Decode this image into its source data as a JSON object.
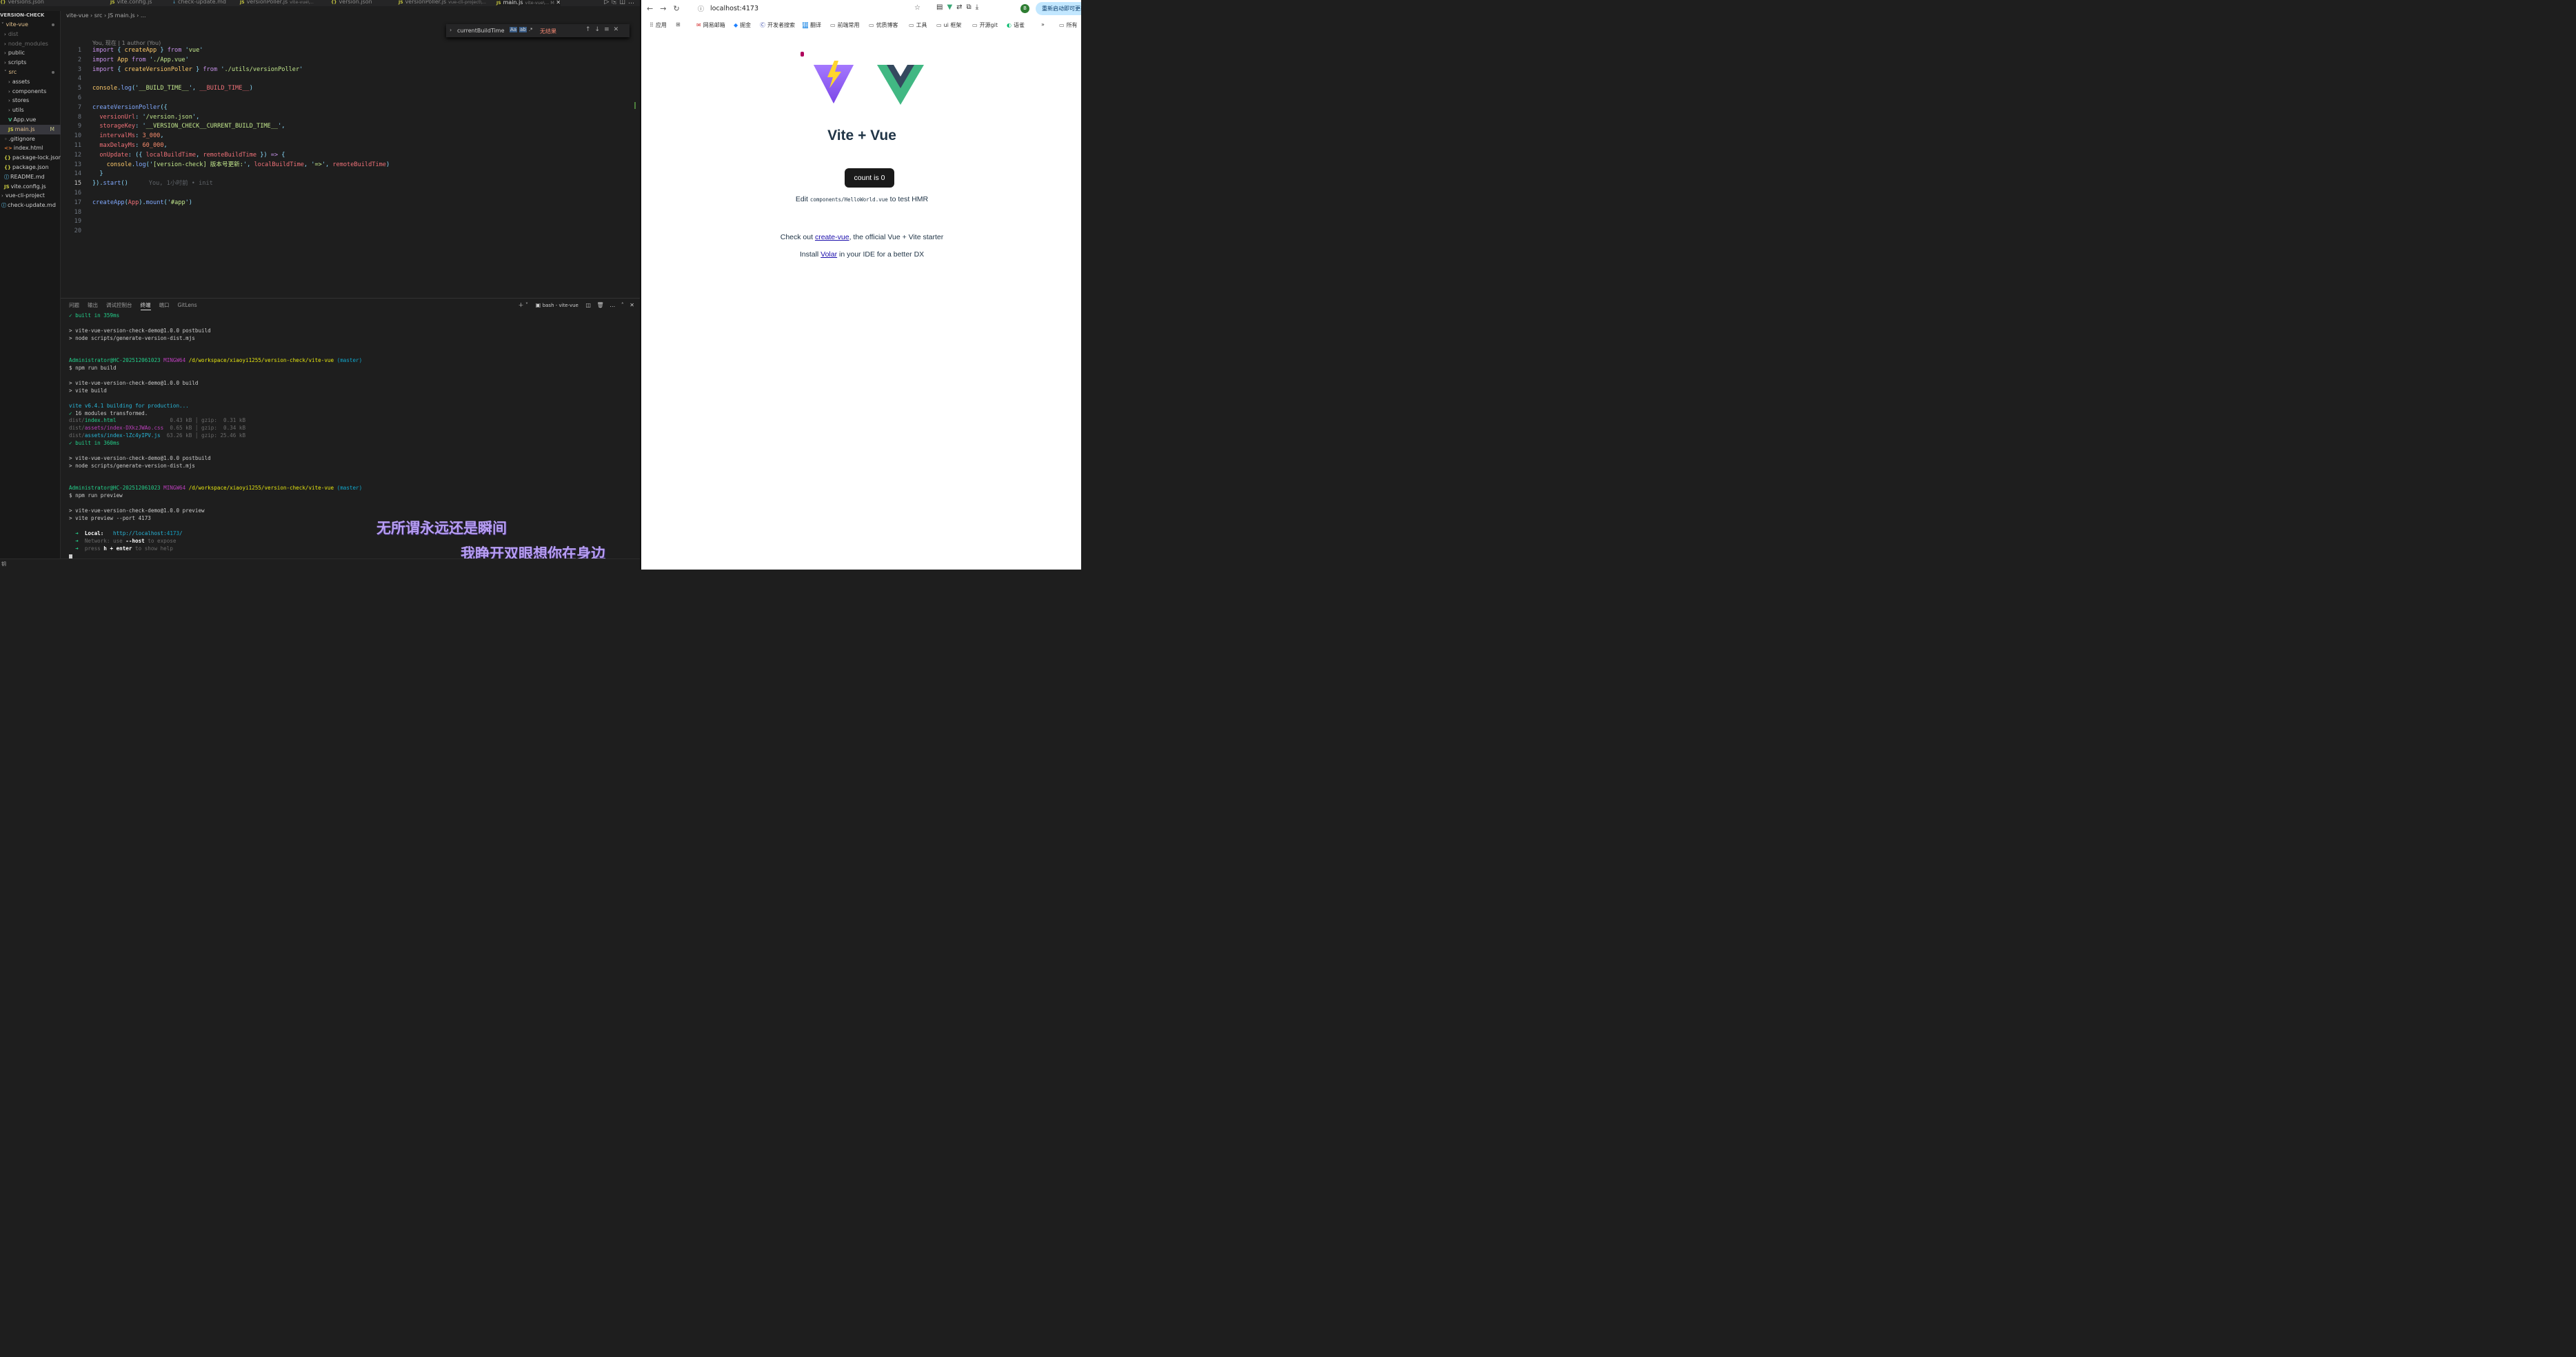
{
  "editor": {
    "tabs": [
      {
        "label": "versions.json",
        "type": "json"
      },
      {
        "label": "vite.config.js",
        "type": "js"
      },
      {
        "label": "check-update.md",
        "type": "md"
      },
      {
        "label": "versionPoller.js",
        "hint": "vite-vue\\...",
        "type": "js"
      },
      {
        "label": "version.json",
        "type": "json"
      },
      {
        "label": "versionPoller.js",
        "hint": "vue-cli-project\\...",
        "type": "js"
      },
      {
        "label": "main.js",
        "hint": "vite-vue\\... M",
        "type": "js",
        "active": true
      }
    ],
    "sidebar": {
      "title": "VERSION-CHECK",
      "items": [
        {
          "label": "vite-vue",
          "kind": "folder-open",
          "depth": 0,
          "color": "#e2c08d"
        },
        {
          "label": "dist",
          "kind": "folder",
          "depth": 1,
          "color": "#6b6b6b"
        },
        {
          "label": "node_modules",
          "kind": "folder",
          "depth": 1,
          "color": "#6b6b6b"
        },
        {
          "label": "public",
          "kind": "folder",
          "depth": 1
        },
        {
          "label": "scripts",
          "kind": "folder",
          "depth": 1
        },
        {
          "label": "src",
          "kind": "folder-open",
          "depth": 1,
          "color": "#e2c08d"
        },
        {
          "label": "assets",
          "kind": "folder",
          "depth": 2
        },
        {
          "label": "components",
          "kind": "folder",
          "depth": 2
        },
        {
          "label": "stores",
          "kind": "folder",
          "depth": 2
        },
        {
          "label": "utils",
          "kind": "folder",
          "depth": 2
        },
        {
          "label": "App.vue",
          "kind": "vue",
          "depth": 2
        },
        {
          "label": "main.js",
          "kind": "js",
          "depth": 2,
          "color": "#e2c08d",
          "mod": "M",
          "selected": true
        },
        {
          "label": ".gitignore",
          "kind": "file",
          "depth": 1
        },
        {
          "label": "index.html",
          "kind": "html",
          "depth": 1
        },
        {
          "label": "package-lock.json",
          "kind": "json",
          "depth": 1
        },
        {
          "label": "package.json",
          "kind": "json",
          "depth": 1
        },
        {
          "label": "README.md",
          "kind": "md",
          "depth": 1
        },
        {
          "label": "vite.config.js",
          "kind": "js",
          "depth": 1
        },
        {
          "label": "vue-cli-project",
          "kind": "folder",
          "depth": 0
        },
        {
          "label": "check-update.md",
          "kind": "md",
          "depth": 0
        }
      ]
    },
    "breadcrumb": [
      "vite-vue",
      "src",
      "JS main.js",
      "..."
    ],
    "find": {
      "query": "currentBuildTime",
      "options": "Aa ab .*",
      "result": "无结果"
    },
    "blame_header": "You, 现在 | 1 author (You)",
    "inline_blame": "You, 1小时前 • init",
    "code": [
      [
        [
          "import ",
          "k2"
        ],
        [
          "{ ",
          "pn"
        ],
        [
          "createApp ",
          "yl"
        ],
        [
          "} ",
          "pn"
        ],
        [
          "from ",
          "k2"
        ],
        [
          "'",
          "pn"
        ],
        [
          "vue",
          "gr"
        ],
        [
          "'",
          "pn"
        ]
      ],
      [
        [
          "import ",
          "k2"
        ],
        [
          "App ",
          "yl"
        ],
        [
          "from ",
          "k2"
        ],
        [
          "'",
          "pn"
        ],
        [
          "./App.vue",
          "gr"
        ],
        [
          "'",
          "pn"
        ]
      ],
      [
        [
          "import ",
          "k2"
        ],
        [
          "{ ",
          "pn"
        ],
        [
          "createVersionPoller ",
          "yl"
        ],
        [
          "} ",
          "pn"
        ],
        [
          "from ",
          "k2"
        ],
        [
          "'",
          "pn"
        ],
        [
          "./utils/versionPoller",
          "gr"
        ],
        [
          "'",
          "pn"
        ]
      ],
      [],
      [
        [
          "console",
          "yl"
        ],
        [
          ".",
          "pn"
        ],
        [
          "log",
          "bl"
        ],
        [
          "(",
          "pn"
        ],
        [
          "'",
          "pn"
        ],
        [
          "__BUILD_TIME__",
          "gr"
        ],
        [
          "', ",
          "pn"
        ],
        [
          "__BUILD_TIME__",
          "vr"
        ],
        [
          ")",
          "pn"
        ]
      ],
      [],
      [
        [
          "createVersionPoller",
          "bl"
        ],
        [
          "({",
          "pn"
        ]
      ],
      [
        [
          "  versionUrl",
          "vr"
        ],
        [
          ": ",
          "pn"
        ],
        [
          "'",
          "pn"
        ],
        [
          "/version.json",
          "gr"
        ],
        [
          "',",
          "pn"
        ]
      ],
      [
        [
          "  storageKey",
          "vr"
        ],
        [
          ": ",
          "pn"
        ],
        [
          "'",
          "pn"
        ],
        [
          "__VERSION_CHECK__CURRENT_BUILD_TIME__",
          "gr"
        ],
        [
          "',",
          "pn"
        ]
      ],
      [
        [
          "  intervalMs",
          "vr"
        ],
        [
          ": ",
          "pn"
        ],
        [
          "3_000",
          "nm"
        ],
        [
          ",",
          "pn"
        ]
      ],
      [
        [
          "  maxDelayMs",
          "vr"
        ],
        [
          ": ",
          "pn"
        ],
        [
          "60_000",
          "nm"
        ],
        [
          ",",
          "pn"
        ]
      ],
      [
        [
          "  onUpdate",
          "vr"
        ],
        [
          ": ",
          "pn"
        ],
        [
          "({ ",
          "pn"
        ],
        [
          "localBuildTime",
          "vr"
        ],
        [
          ", ",
          "pn"
        ],
        [
          "remoteBuildTime ",
          "vr"
        ],
        [
          "}) ",
          "pn"
        ],
        [
          "=> ",
          "k2"
        ],
        [
          "{",
          "pn"
        ]
      ],
      [
        [
          "    console",
          "yl"
        ],
        [
          ".",
          "pn"
        ],
        [
          "log",
          "bl"
        ],
        [
          "(",
          "pn"
        ],
        [
          "'",
          "pn"
        ],
        [
          "[version-check] 版本号更新:",
          "gr"
        ],
        [
          "', ",
          "pn"
        ],
        [
          "localBuildTime",
          "vr"
        ],
        [
          ", ",
          "pn"
        ],
        [
          "'",
          "pn"
        ],
        [
          "=>",
          "gr"
        ],
        [
          "', ",
          "pn"
        ],
        [
          "remoteBuildTime",
          "vr"
        ],
        [
          ")",
          "pn"
        ]
      ],
      [
        [
          "  }",
          "pn"
        ]
      ],
      [
        [
          "})",
          "pn"
        ],
        [
          ".",
          "pn"
        ],
        [
          "start",
          "bl"
        ],
        [
          "()",
          "pn"
        ]
      ],
      [],
      [
        [
          "createApp",
          "bl"
        ],
        [
          "(",
          "pn"
        ],
        [
          "App",
          "vr"
        ],
        [
          ")",
          "pn"
        ],
        [
          ".",
          "pn"
        ],
        [
          "mount",
          "bl"
        ],
        [
          "(",
          "pn"
        ],
        [
          "'",
          "pn"
        ],
        [
          "#app",
          "gr"
        ],
        [
          "')",
          "pn"
        ]
      ],
      [],
      [],
      []
    ],
    "current_line": 15,
    "panel_tabs": [
      "问题",
      "输出",
      "调试控制台",
      "终端",
      "端口",
      "GitLens"
    ],
    "active_panel_tab": "终端",
    "terminal_name": "bash - vite-vue",
    "terminal": [
      [
        [
          "✓ built in 359ms",
          "g"
        ]
      ],
      [],
      [
        [
          "> vite-vue-version-check-demo@1.0.0 postbuild",
          ""
        ]
      ],
      [
        [
          "> node scripts/generate-version-dist.mjs",
          ""
        ]
      ],
      [],
      [],
      [
        [
          "Administrator@HC-202512061023 ",
          "g"
        ],
        [
          "MINGW64 ",
          "m"
        ],
        [
          "/d/workspace/xiaoyi1255/version-check/vite-vue ",
          "yel"
        ],
        [
          "(master)",
          "cy"
        ]
      ],
      [
        [
          "$ npm run build",
          ""
        ]
      ],
      [],
      [
        [
          "> vite-vue-version-check-demo@1.0.0 build",
          ""
        ]
      ],
      [
        [
          "> vite build",
          ""
        ]
      ],
      [],
      [
        [
          "vite v6.4.1 building for production...",
          "c"
        ]
      ],
      [
        [
          "✓ ",
          "g"
        ],
        [
          "16 modules transformed.",
          ""
        ]
      ],
      [
        [
          "dist/",
          "dim"
        ],
        [
          "index.html                 ",
          "g"
        ],
        [
          "0.43 kB",
          "dim"
        ],
        [
          " │ gzip:  0.31 kB",
          "dim"
        ]
      ],
      [
        [
          "dist/",
          "dim"
        ],
        [
          "assets/index-DXkzJWAo.css  ",
          "m"
        ],
        [
          "0.65 kB",
          "dim"
        ],
        [
          " │ gzip:  0.34 kB",
          "dim"
        ]
      ],
      [
        [
          "dist/",
          "dim"
        ],
        [
          "assets/index-lZc4yIPV.js  ",
          "c"
        ],
        [
          "63.26 kB",
          "dim"
        ],
        [
          " │ gzip: 25.46 kB",
          "dim"
        ]
      ],
      [
        [
          "✓ built in 360ms",
          "g"
        ]
      ],
      [],
      [
        [
          "> vite-vue-version-check-demo@1.0.0 postbuild",
          ""
        ]
      ],
      [
        [
          "> node scripts/generate-version-dist.mjs",
          ""
        ]
      ],
      [],
      [],
      [
        [
          "Administrator@HC-202512061023 ",
          "g"
        ],
        [
          "MINGW64 ",
          "m"
        ],
        [
          "/d/workspace/xiaoyi1255/version-check/vite-vue ",
          "yel"
        ],
        [
          "(master)",
          "cy"
        ]
      ],
      [
        [
          "$ npm run preview",
          ""
        ]
      ],
      [],
      [
        [
          "> vite-vue-version-check-demo@1.0.0 preview",
          ""
        ]
      ],
      [
        [
          "> vite preview --port 4173",
          ""
        ]
      ],
      [],
      [
        [
          "  ➜  ",
          "g"
        ],
        [
          "Local:   ",
          "wb"
        ],
        [
          "http://localhost:",
          "c"
        ],
        [
          "4173",
          "cy"
        ],
        [
          "/",
          "c"
        ]
      ],
      [
        [
          "  ➜  ",
          "g"
        ],
        [
          "Network: use ",
          "dim"
        ],
        [
          "--host",
          "wb"
        ],
        [
          " to expose",
          "dim"
        ]
      ],
      [
        [
          "  ➜  ",
          "g"
        ],
        [
          "press ",
          "dim"
        ],
        [
          "h + enter",
          "wb"
        ],
        [
          " to show help",
          "dim"
        ]
      ]
    ],
    "subtitle1": "无所谓永远还是瞬间",
    "subtitle2": "我睁开双眼想你在身边",
    "status_left": "钥"
  },
  "browser": {
    "url": "localhost:4173",
    "restart_label": "重新启动即可更新",
    "avatar": "B",
    "bookmarks": [
      {
        "label": "应用",
        "icon": "grid"
      },
      {
        "label": "",
        "icon": "grid2"
      },
      {
        "label": "网易邮箱",
        "icon": "mail"
      },
      {
        "label": "掘金",
        "icon": "juejin"
      },
      {
        "label": "开发者搜索",
        "icon": "search"
      },
      {
        "label": "翻译",
        "icon": "translate"
      },
      {
        "label": "前端常用",
        "icon": "folder"
      },
      {
        "label": "优质博客",
        "icon": "folder"
      },
      {
        "label": "工具",
        "icon": "folder"
      },
      {
        "label": "ui 框架",
        "icon": "folder"
      },
      {
        "label": "开源git",
        "icon": "folder"
      },
      {
        "label": "语雀",
        "icon": "yuque"
      },
      {
        "label": "»",
        "icon": "more"
      },
      {
        "label": "所有",
        "icon": "folder"
      }
    ],
    "page": {
      "title": "Vite + Vue",
      "count_label": "count is 0",
      "edit_prefix": "Edit ",
      "edit_code": "components/HelloWorld.vue",
      "edit_suffix": " to test HMR",
      "check_prefix": "Check out ",
      "check_link": "create-vue",
      "check_suffix": ", the official Vue + Vite starter",
      "install_prefix": "Install ",
      "install_link": "Volar",
      "install_suffix": " in your IDE for a better DX"
    }
  }
}
